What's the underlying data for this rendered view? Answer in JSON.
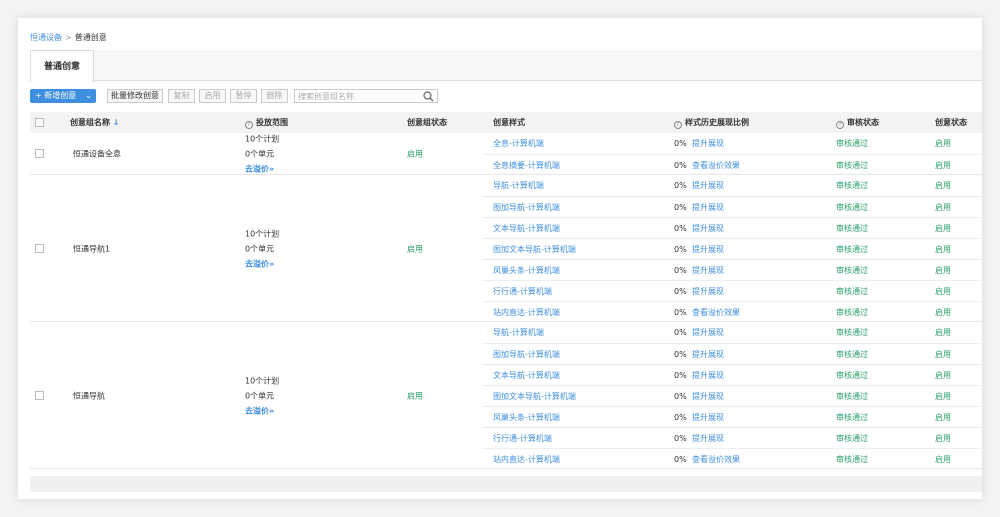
{
  "breadcrumb": {
    "parent": "恒通设备",
    "separator": ">",
    "current": "普通创意"
  },
  "tab": {
    "label": "普通创意"
  },
  "toolbar": {
    "new_label": "+ 新增创意",
    "new_caret": "⌄",
    "buttons": [
      "批量修改创意",
      "复制",
      "启用",
      "暂停",
      "删除"
    ],
    "search_placeholder": "搜索创意组名称"
  },
  "columns": {
    "name": "创意组名称",
    "name_sort": "↓",
    "scope": "投放范围",
    "group_status": "创意组状态",
    "style": "创意样式",
    "ratio": "样式历史展现比例",
    "audit": "审核状态",
    "status": "创意状态",
    "help": "?"
  },
  "groups": [
    {
      "name": "恒通设备全息",
      "plans": "10个计划",
      "units": "0个单元",
      "bid_link": "去溢价»",
      "status": "启用",
      "rows": [
        {
          "style": "全息-计算机端",
          "pct": "0%",
          "action": "提升展现",
          "audit": "审核通过",
          "status": "启用"
        },
        {
          "style": "全息摘要-计算机端",
          "pct": "0%",
          "action": "查看溢价效果",
          "audit": "审核通过",
          "status": "启用"
        }
      ]
    },
    {
      "name": "恒通导航1",
      "plans": "10个计划",
      "units": "0个单元",
      "bid_link": "去溢价»",
      "status": "启用",
      "rows": [
        {
          "style": "导航-计算机端",
          "pct": "0%",
          "action": "提升展现",
          "audit": "审核通过",
          "status": "启用"
        },
        {
          "style": "图加导航-计算机端",
          "pct": "0%",
          "action": "提升展现",
          "audit": "审核通过",
          "status": "启用"
        },
        {
          "style": "文本导航-计算机端",
          "pct": "0%",
          "action": "提升展现",
          "audit": "审核通过",
          "status": "启用"
        },
        {
          "style": "图加文本导航-计算机端",
          "pct": "0%",
          "action": "提升展现",
          "audit": "审核通过",
          "status": "启用"
        },
        {
          "style": "凤巢头条-计算机端",
          "pct": "0%",
          "action": "提升展现",
          "audit": "审核通过",
          "status": "启用"
        },
        {
          "style": "行行通-计算机端",
          "pct": "0%",
          "action": "提升展现",
          "audit": "审核通过",
          "status": "启用"
        },
        {
          "style": "站内直达-计算机端",
          "pct": "0%",
          "action": "查看溢价效果",
          "audit": "审核通过",
          "status": "启用"
        }
      ]
    },
    {
      "name": "恒通导航",
      "plans": "10个计划",
      "units": "0个单元",
      "bid_link": "去溢价»",
      "status": "启用",
      "rows": [
        {
          "style": "导航-计算机端",
          "pct": "0%",
          "action": "提升展现",
          "audit": "审核通过",
          "status": "启用"
        },
        {
          "style": "图加导航-计算机端",
          "pct": "0%",
          "action": "提升展现",
          "audit": "审核通过",
          "status": "启用"
        },
        {
          "style": "文本导航-计算机端",
          "pct": "0%",
          "action": "提升展现",
          "audit": "审核通过",
          "status": "启用"
        },
        {
          "style": "图加文本导航-计算机端",
          "pct": "0%",
          "action": "提升展现",
          "audit": "审核通过",
          "status": "启用"
        },
        {
          "style": "凤巢头条-计算机端",
          "pct": "0%",
          "action": "提升展现",
          "audit": "审核通过",
          "status": "启用"
        },
        {
          "style": "行行通-计算机端",
          "pct": "0%",
          "action": "提升展现",
          "audit": "审核通过",
          "status": "启用"
        },
        {
          "style": "站内直达-计算机端",
          "pct": "0%",
          "action": "查看溢价效果",
          "audit": "审核通过",
          "status": "启用"
        }
      ]
    }
  ]
}
